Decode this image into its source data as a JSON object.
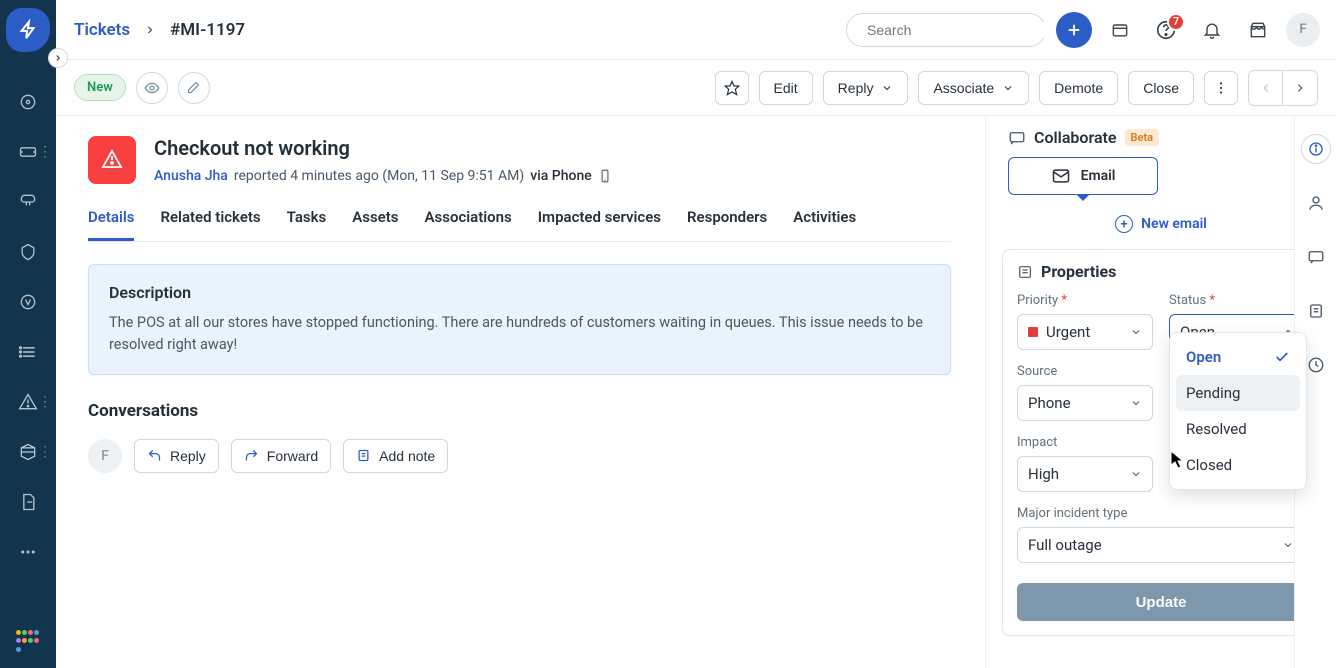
{
  "breadcrumb": {
    "root": "Tickets",
    "id": "#MI-1197"
  },
  "search": {
    "placeholder": "Search"
  },
  "topbar": {
    "notification_count": "7",
    "avatar_initial": "F"
  },
  "ticket_status_pill": "New",
  "actions": {
    "edit": "Edit",
    "reply": "Reply",
    "associate": "Associate",
    "demote": "Demote",
    "close": "Close"
  },
  "ticket": {
    "title": "Checkout not working",
    "reporter": "Anusha Jha",
    "reported_text": "reported 4 minutes ago (Mon, 11 Sep 9:51 AM)",
    "via_text": "via Phone"
  },
  "tabs": [
    "Details",
    "Related tickets",
    "Tasks",
    "Assets",
    "Associations",
    "Impacted services",
    "Responders",
    "Activities"
  ],
  "description": {
    "heading": "Description",
    "body": "The POS at all our stores have stopped functioning. There are hundreds of customers waiting in queues. This issue needs to be resolved right away!"
  },
  "conversations": {
    "heading": "Conversations",
    "avatar_initial": "F",
    "reply": "Reply",
    "forward": "Forward",
    "add_note": "Add note"
  },
  "collaborate": {
    "heading": "Collaborate",
    "beta": "Beta",
    "email_btn": "Email",
    "new_email": "New email"
  },
  "properties": {
    "heading": "Properties",
    "priority": {
      "label": "Priority",
      "value": "Urgent"
    },
    "status": {
      "label": "Status",
      "value": "Open",
      "options": [
        "Open",
        "Pending",
        "Resolved",
        "Closed"
      ]
    },
    "source": {
      "label": "Source",
      "value": "Phone"
    },
    "impact": {
      "label": "Impact",
      "value": "High"
    },
    "major_incident_type": {
      "label": "Major incident type",
      "value": "Full outage"
    },
    "update": "Update"
  }
}
